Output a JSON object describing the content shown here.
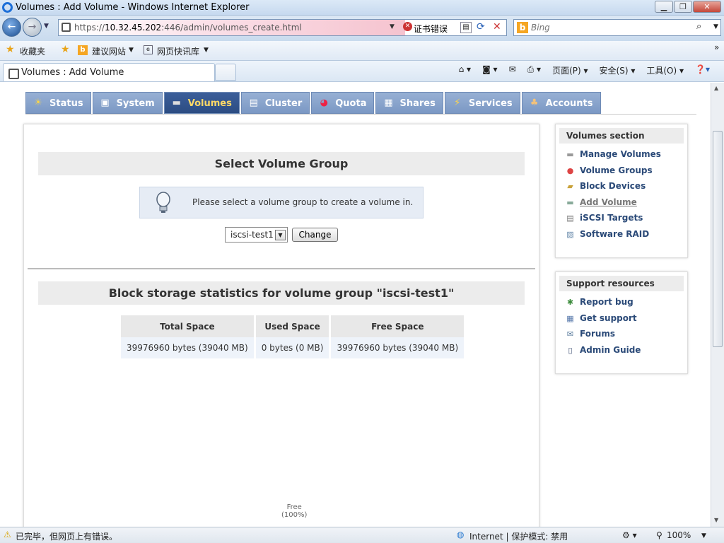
{
  "window": {
    "title": "Volumes : Add Volume - Windows Internet Explorer",
    "min": "0",
    "max": "1",
    "close": "r"
  },
  "address": {
    "url_prefix": "https://",
    "url_host": "10.32.45.202",
    "url_rest": ":446/admin/volumes_create.html",
    "cert_error": "证书错误"
  },
  "search": {
    "placeholder": "Bing"
  },
  "favorites": {
    "label": "收藏夹",
    "suggested": "建议网站",
    "webslice": "网页快讯库"
  },
  "tab": {
    "title": "Volumes : Add Volume"
  },
  "commandbar": {
    "page": "页面(P)",
    "safety": "安全(S)",
    "tools": "工具(O)"
  },
  "nav": {
    "items": [
      {
        "label": "Status",
        "icon": "☀"
      },
      {
        "label": "System",
        "icon": "▣"
      },
      {
        "label": "Volumes",
        "icon": "▬"
      },
      {
        "label": "Cluster",
        "icon": "▤"
      },
      {
        "label": "Quota",
        "icon": "◕"
      },
      {
        "label": "Shares",
        "icon": "▦"
      },
      {
        "label": "Services",
        "icon": "⚡"
      },
      {
        "label": "Accounts",
        "icon": "♣"
      }
    ],
    "active": "Volumes"
  },
  "select_group": {
    "heading": "Select Volume Group",
    "info": "Please select a volume group to create a volume in.",
    "selected": "iscsi-test1",
    "button": "Change"
  },
  "stats": {
    "heading": "Block storage statistics for volume group \"iscsi-test1\"",
    "columns": [
      "Total Space",
      "Used Space",
      "Free Space"
    ],
    "row": [
      "39976960 bytes (39040 MB)",
      "0 bytes (0 MB)",
      "39976960 bytes (39040 MB)"
    ],
    "pie_label": "Free",
    "pie_pct": "(100%)"
  },
  "sidebar": {
    "volumes_section": {
      "title": "Volumes section",
      "links": [
        {
          "label": "Manage Volumes",
          "icon": "▬"
        },
        {
          "label": "Volume Groups",
          "icon": "●"
        },
        {
          "label": "Block Devices",
          "icon": "▰"
        },
        {
          "label": "Add Volume",
          "icon": "▬"
        },
        {
          "label": "iSCSI Targets",
          "icon": "▤"
        },
        {
          "label": "Software RAID",
          "icon": "▧"
        }
      ]
    },
    "support": {
      "title": "Support resources",
      "links": [
        {
          "label": "Report bug",
          "icon": "✱"
        },
        {
          "label": "Get support",
          "icon": "▦"
        },
        {
          "label": "Forums",
          "icon": "✉"
        },
        {
          "label": "Admin Guide",
          "icon": "▯"
        }
      ]
    }
  },
  "statusbar": {
    "message": "已完毕，但网页上有错误。",
    "zone": "Internet | 保护模式: 禁用",
    "zoom": "100%"
  },
  "colors": {
    "nav_active_bg": "#2c4c82",
    "nav_bg": "#7b98c4",
    "link": "#2b4a78"
  }
}
